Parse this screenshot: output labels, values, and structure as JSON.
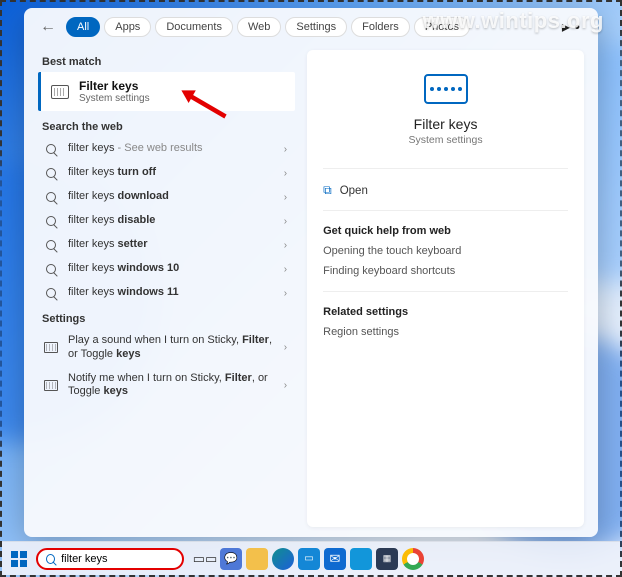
{
  "watermark": "www.wintips.org",
  "tabs": {
    "all": "All",
    "apps": "Apps",
    "documents": "Documents",
    "web": "Web",
    "settings": "Settings",
    "folders": "Folders",
    "photos": "Photos",
    "more": "▸•"
  },
  "left": {
    "best_match_label": "Best match",
    "best_match": {
      "title": "Filter keys",
      "subtitle": "System settings"
    },
    "search_web_label": "Search the web",
    "web_results": [
      {
        "prefix": "filter keys",
        "suffix": " - See web results"
      },
      {
        "prefix": "filter keys ",
        "bold": "turn off"
      },
      {
        "prefix": "filter keys ",
        "bold": "download"
      },
      {
        "prefix": "filter keys ",
        "bold": "disable"
      },
      {
        "prefix": "filter keys ",
        "bold": "setter"
      },
      {
        "prefix": "filter keys ",
        "bold": "windows 10"
      },
      {
        "prefix": "filter keys ",
        "bold": "windows 11"
      }
    ],
    "settings_label": "Settings",
    "settings_items": [
      {
        "pre": "Play a sound when I turn on Sticky, ",
        "bold1": "Filter",
        "mid": ", or Toggle ",
        "bold2": "keys"
      },
      {
        "pre": "Notify me when I turn on Sticky, ",
        "bold1": "Filter",
        "mid": ", or Toggle ",
        "bold2": "keys"
      }
    ]
  },
  "right": {
    "title": "Filter keys",
    "subtitle": "System settings",
    "open_label": "Open",
    "quick_help_label": "Get quick help from web",
    "quick_links": [
      "Opening the touch keyboard",
      "Finding keyboard shortcuts"
    ],
    "related_label": "Related settings",
    "related_links": [
      "Region settings"
    ]
  },
  "taskbar": {
    "search_value": "filter keys"
  }
}
